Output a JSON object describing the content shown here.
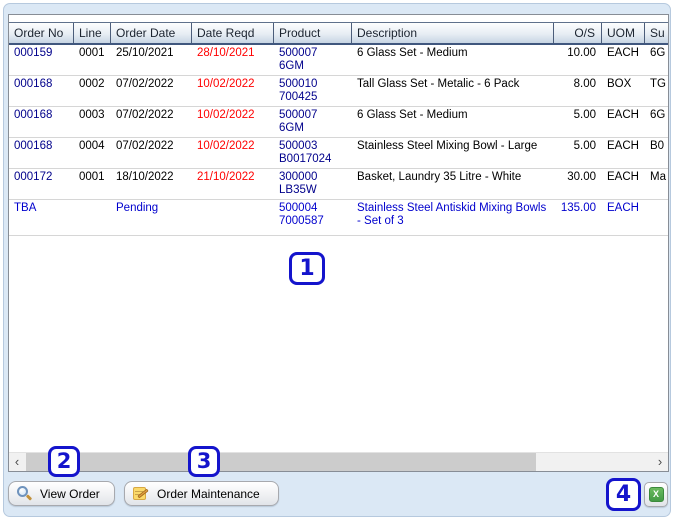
{
  "colors": {
    "frame_bg": "#dbe8f5",
    "order_link_navy": "#00008B",
    "pending_blue": "#0000CD",
    "overdue_red": "#FF0000",
    "callout_blue": "#1414CC",
    "excel_green": "#4EA24E"
  },
  "grid": {
    "columns": {
      "order_no": "Order No",
      "line": "Line",
      "order_date": "Order Date",
      "date_reqd": "Date Reqd",
      "product": "Product",
      "description": "Description",
      "os": "O/S",
      "uom": "UOM",
      "su": "Su"
    },
    "rows": [
      {
        "order_no": "000159",
        "line": "0001",
        "order_date": "25/10/2021",
        "date_reqd": "28/10/2021",
        "product1": "500007",
        "product2": "6GM",
        "description": "6 Glass Set - Medium",
        "os": "10.00",
        "uom": "EACH",
        "su": "6G"
      },
      {
        "order_no": "000168",
        "line": "0002",
        "order_date": "07/02/2022",
        "date_reqd": "10/02/2022",
        "product1": "500010",
        "product2": "700425",
        "description": "Tall Glass Set - Metalic - 6 Pack",
        "os": "8.00",
        "uom": "BOX",
        "su": "TG"
      },
      {
        "order_no": "000168",
        "line": "0003",
        "order_date": "07/02/2022",
        "date_reqd": "10/02/2022",
        "product1": "500007",
        "product2": "6GM",
        "description": "6 Glass Set - Medium",
        "os": "5.00",
        "uom": "EACH",
        "su": "6G"
      },
      {
        "order_no": "000168",
        "line": "0004",
        "order_date": "07/02/2022",
        "date_reqd": "10/02/2022",
        "product1": "500003",
        "product2": "B0017024",
        "description": "Stainless Steel Mixing Bowl - Large",
        "os": "5.00",
        "uom": "EACH",
        "su": "B0"
      },
      {
        "order_no": "000172",
        "line": "0001",
        "order_date": "18/10/2022",
        "date_reqd": "21/10/2022",
        "product1": "300000",
        "product2": "LB35W",
        "description": "Basket, Laundry 35 Litre - White",
        "os": "30.00",
        "uom": "EACH",
        "su": "Ma"
      },
      {
        "order_no": "TBA",
        "line": "",
        "order_date": "Pending",
        "date_reqd": "",
        "product1": "500004",
        "product2": "7000587",
        "description": "Stainless Steel Antiskid Mixing Bowls - Set of 3",
        "os": "135.00",
        "uom": "EACH",
        "su": ""
      }
    ]
  },
  "scrollbar": {
    "left_glyph": "‹",
    "right_glyph": "›"
  },
  "toolbar": {
    "view_order_label": "View Order",
    "order_maintenance_label": "Order Maintenance",
    "excel_glyph": "X"
  },
  "callouts": {
    "one": "1",
    "two": "2",
    "three": "3",
    "four": "4"
  }
}
